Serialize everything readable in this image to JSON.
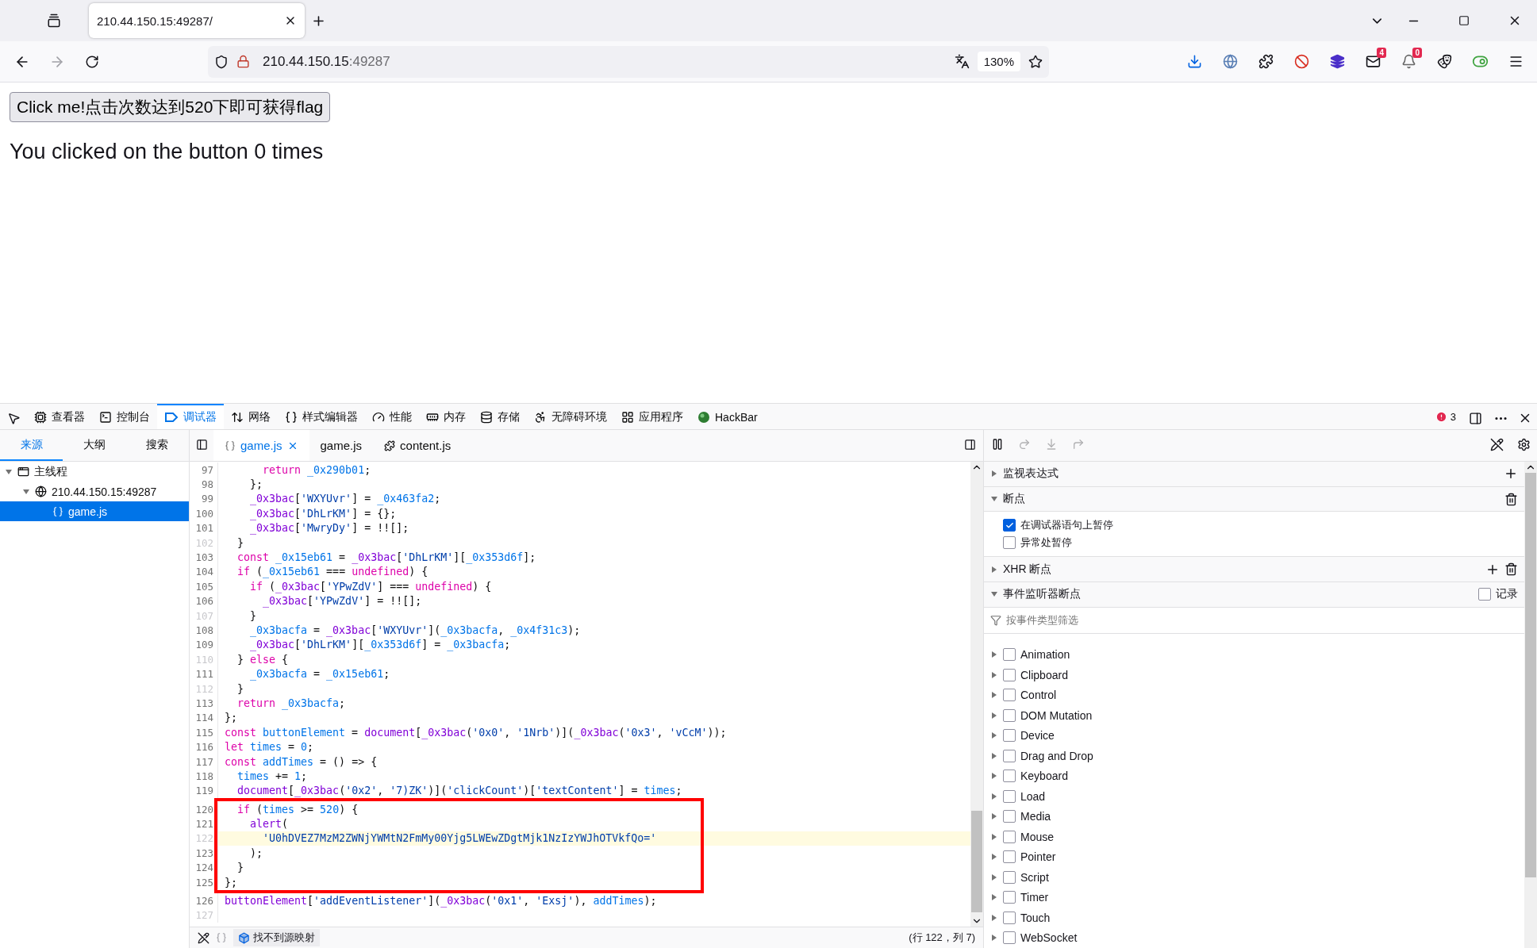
{
  "browser": {
    "tabs": [
      {
        "title": "210.44.150.15:49287/",
        "selected": true
      }
    ],
    "url_host": "210.44.150.15",
    "url_port": ":49287",
    "zoom": "130%",
    "toolbar_icons": [
      {
        "kind": "download"
      },
      {
        "kind": "globe"
      },
      {
        "kind": "puzzle"
      },
      {
        "kind": "stop"
      },
      {
        "kind": "cube"
      },
      {
        "kind": "mail",
        "badge": "4"
      },
      {
        "kind": "bell",
        "badge": "0"
      },
      {
        "kind": "mask"
      },
      {
        "kind": "toggle"
      },
      {
        "kind": "menu"
      }
    ]
  },
  "page": {
    "button": "Click me!点击次数达到520下即可获得flag",
    "message": "You clicked on the button 0 times"
  },
  "devtools": {
    "tools": [
      {
        "kind": "inspector",
        "label": "查看器",
        "selected": false
      },
      {
        "kind": "console",
        "label": "控制台",
        "selected": false
      },
      {
        "kind": "debugger",
        "label": "调试器",
        "selected": true
      },
      {
        "kind": "network",
        "label": "网络",
        "selected": false
      },
      {
        "kind": "style",
        "label": "样式编辑器",
        "selected": false
      },
      {
        "kind": "performance",
        "label": "性能",
        "selected": false
      },
      {
        "kind": "memory",
        "label": "内存",
        "selected": false
      },
      {
        "kind": "storage",
        "label": "存储",
        "selected": false
      },
      {
        "kind": "accessibility",
        "label": "无障碍环境",
        "selected": false
      },
      {
        "kind": "application",
        "label": "应用程序",
        "selected": false
      },
      {
        "kind": "hackbar",
        "label": "HackBar",
        "selected": false
      }
    ],
    "error_count": "3",
    "panel_tabs": [
      {
        "label": "来源",
        "selected": true
      },
      {
        "label": "大纲",
        "selected": false
      },
      {
        "label": "搜索",
        "selected": false
      }
    ],
    "file_tabs": [
      {
        "kind": "pretty",
        "label": "game.js",
        "selected": true
      },
      {
        "kind": "plain",
        "label": "game.js",
        "selected": false
      },
      {
        "kind": "extension",
        "label": "content.js",
        "selected": false
      }
    ],
    "tree": [
      {
        "kind": "thread",
        "label": "主线程",
        "expanded": true,
        "selected": false,
        "children": [
          {
            "kind": "host",
            "label": "210.44.150.15:49287",
            "expanded": true,
            "selected": false,
            "children": [
              {
                "kind": "file",
                "label": "game.js",
                "selected": true
              }
            ]
          }
        ]
      }
    ],
    "code": [
      {
        "n": "97",
        "breakable": true,
        "current": false,
        "boxed": false,
        "tokens": [
          {
            "kind": "kw",
            "text": "      return"
          },
          {
            "kind": "var",
            "text": " _0x290b01"
          },
          {
            "kind": "plain",
            "text": ";"
          }
        ]
      },
      {
        "n": "98",
        "breakable": true,
        "current": false,
        "boxed": false,
        "tokens": [
          {
            "kind": "plain",
            "text": "    };"
          }
        ]
      },
      {
        "n": "99",
        "breakable": true,
        "current": false,
        "boxed": false,
        "tokens": [
          {
            "kind": "fn",
            "text": "    _0x3bac"
          },
          {
            "kind": "plain",
            "text": "["
          },
          {
            "kind": "str",
            "text": "'WXYUvr'"
          },
          {
            "kind": "plain",
            "text": "] ="
          },
          {
            "kind": "var",
            "text": " _0x463fa2"
          },
          {
            "kind": "plain",
            "text": ";"
          }
        ]
      },
      {
        "n": "100",
        "breakable": true,
        "current": false,
        "boxed": false,
        "tokens": [
          {
            "kind": "fn",
            "text": "    _0x3bac"
          },
          {
            "kind": "plain",
            "text": "["
          },
          {
            "kind": "str",
            "text": "'DhLrKM'"
          },
          {
            "kind": "plain",
            "text": "] = {};"
          }
        ]
      },
      {
        "n": "101",
        "breakable": true,
        "current": false,
        "boxed": false,
        "tokens": [
          {
            "kind": "fn",
            "text": "    _0x3bac"
          },
          {
            "kind": "plain",
            "text": "["
          },
          {
            "kind": "str",
            "text": "'MwryDy'"
          },
          {
            "kind": "plain",
            "text": "] = !![];"
          }
        ]
      },
      {
        "n": "102",
        "breakable": false,
        "current": false,
        "boxed": false,
        "tokens": [
          {
            "kind": "plain",
            "text": "  }"
          }
        ]
      },
      {
        "n": "103",
        "breakable": true,
        "current": false,
        "boxed": false,
        "tokens": [
          {
            "kind": "kw",
            "text": "  const"
          },
          {
            "kind": "var",
            "text": " _0x15eb61"
          },
          {
            "kind": "plain",
            "text": " ="
          },
          {
            "kind": "fn",
            "text": " _0x3bac"
          },
          {
            "kind": "plain",
            "text": "["
          },
          {
            "kind": "str",
            "text": "'DhLrKM'"
          },
          {
            "kind": "plain",
            "text": "]["
          },
          {
            "kind": "var",
            "text": "_0x353d6f"
          },
          {
            "kind": "plain",
            "text": "];"
          }
        ]
      },
      {
        "n": "104",
        "breakable": true,
        "current": false,
        "boxed": false,
        "tokens": [
          {
            "kind": "kw",
            "text": "  if"
          },
          {
            "kind": "plain",
            "text": " ("
          },
          {
            "kind": "var",
            "text": "_0x15eb61"
          },
          {
            "kind": "plain",
            "text": " ==="
          },
          {
            "kind": "kw",
            "text": " undefined"
          },
          {
            "kind": "plain",
            "text": ") {"
          }
        ]
      },
      {
        "n": "105",
        "breakable": true,
        "current": false,
        "boxed": false,
        "tokens": [
          {
            "kind": "kw",
            "text": "    if"
          },
          {
            "kind": "plain",
            "text": " ("
          },
          {
            "kind": "fn",
            "text": "_0x3bac"
          },
          {
            "kind": "plain",
            "text": "["
          },
          {
            "kind": "str",
            "text": "'YPwZdV'"
          },
          {
            "kind": "plain",
            "text": "] ==="
          },
          {
            "kind": "kw",
            "text": " undefined"
          },
          {
            "kind": "plain",
            "text": ") {"
          }
        ]
      },
      {
        "n": "106",
        "breakable": true,
        "current": false,
        "boxed": false,
        "tokens": [
          {
            "kind": "fn",
            "text": "      _0x3bac"
          },
          {
            "kind": "plain",
            "text": "["
          },
          {
            "kind": "str",
            "text": "'YPwZdV'"
          },
          {
            "kind": "plain",
            "text": "] = !![];"
          }
        ]
      },
      {
        "n": "107",
        "breakable": false,
        "current": false,
        "boxed": false,
        "tokens": [
          {
            "kind": "plain",
            "text": "    }"
          }
        ]
      },
      {
        "n": "108",
        "breakable": true,
        "current": false,
        "boxed": false,
        "tokens": [
          {
            "kind": "var",
            "text": "    _0x3bacfa"
          },
          {
            "kind": "plain",
            "text": " ="
          },
          {
            "kind": "fn",
            "text": " _0x3bac"
          },
          {
            "kind": "plain",
            "text": "["
          },
          {
            "kind": "str",
            "text": "'WXYUvr'"
          },
          {
            "kind": "plain",
            "text": "]("
          },
          {
            "kind": "var",
            "text": "_0x3bacfa"
          },
          {
            "kind": "plain",
            "text": ","
          },
          {
            "kind": "var",
            "text": " _0x4f31c3"
          },
          {
            "kind": "plain",
            "text": ");"
          }
        ]
      },
      {
        "n": "109",
        "breakable": true,
        "current": false,
        "boxed": false,
        "tokens": [
          {
            "kind": "fn",
            "text": "    _0x3bac"
          },
          {
            "kind": "plain",
            "text": "["
          },
          {
            "kind": "str",
            "text": "'DhLrKM'"
          },
          {
            "kind": "plain",
            "text": "]["
          },
          {
            "kind": "var",
            "text": "_0x353d6f"
          },
          {
            "kind": "plain",
            "text": "] ="
          },
          {
            "kind": "var",
            "text": " _0x3bacfa"
          },
          {
            "kind": "plain",
            "text": ";"
          }
        ]
      },
      {
        "n": "110",
        "breakable": false,
        "current": false,
        "boxed": false,
        "tokens": [
          {
            "kind": "plain",
            "text": "  }"
          },
          {
            "kind": "kw",
            "text": " else"
          },
          {
            "kind": "plain",
            "text": " {"
          }
        ]
      },
      {
        "n": "111",
        "breakable": true,
        "current": false,
        "boxed": false,
        "tokens": [
          {
            "kind": "var",
            "text": "    _0x3bacfa"
          },
          {
            "kind": "plain",
            "text": " ="
          },
          {
            "kind": "var",
            "text": " _0x15eb61"
          },
          {
            "kind": "plain",
            "text": ";"
          }
        ]
      },
      {
        "n": "112",
        "breakable": false,
        "current": false,
        "boxed": false,
        "tokens": [
          {
            "kind": "plain",
            "text": "  }"
          }
        ]
      },
      {
        "n": "113",
        "breakable": true,
        "current": false,
        "boxed": false,
        "tokens": [
          {
            "kind": "kw",
            "text": "  return"
          },
          {
            "kind": "var",
            "text": " _0x3bacfa"
          },
          {
            "kind": "plain",
            "text": ";"
          }
        ]
      },
      {
        "n": "114",
        "breakable": true,
        "current": false,
        "boxed": false,
        "tokens": [
          {
            "kind": "plain",
            "text": "};"
          }
        ]
      },
      {
        "n": "115",
        "breakable": true,
        "current": false,
        "boxed": false,
        "tokens": [
          {
            "kind": "kw",
            "text": "const"
          },
          {
            "kind": "var",
            "text": " buttonElement"
          },
          {
            "kind": "plain",
            "text": " ="
          },
          {
            "kind": "fn",
            "text": " document"
          },
          {
            "kind": "plain",
            "text": "["
          },
          {
            "kind": "fn",
            "text": "_0x3bac"
          },
          {
            "kind": "plain",
            "text": "("
          },
          {
            "kind": "str",
            "text": "'0x0'"
          },
          {
            "kind": "plain",
            "text": ","
          },
          {
            "kind": "str",
            "text": " '1Nrb'"
          },
          {
            "kind": "plain",
            "text": ")]("
          },
          {
            "kind": "fn",
            "text": "_0x3bac"
          },
          {
            "kind": "plain",
            "text": "("
          },
          {
            "kind": "str",
            "text": "'0x3'"
          },
          {
            "kind": "plain",
            "text": ","
          },
          {
            "kind": "str",
            "text": " 'vCcM'"
          },
          {
            "kind": "plain",
            "text": "));"
          }
        ]
      },
      {
        "n": "116",
        "breakable": true,
        "current": false,
        "boxed": false,
        "tokens": [
          {
            "kind": "kw",
            "text": "let"
          },
          {
            "kind": "var",
            "text": " times"
          },
          {
            "kind": "plain",
            "text": " ="
          },
          {
            "kind": "num",
            "text": " 0"
          },
          {
            "kind": "plain",
            "text": ";"
          }
        ]
      },
      {
        "n": "117",
        "breakable": true,
        "current": false,
        "boxed": false,
        "tokens": [
          {
            "kind": "kw",
            "text": "const"
          },
          {
            "kind": "var",
            "text": " addTimes"
          },
          {
            "kind": "plain",
            "text": " = () => {"
          }
        ]
      },
      {
        "n": "118",
        "breakable": true,
        "current": false,
        "boxed": false,
        "tokens": [
          {
            "kind": "var",
            "text": "  times"
          },
          {
            "kind": "plain",
            "text": " +="
          },
          {
            "kind": "num",
            "text": " 1"
          },
          {
            "kind": "plain",
            "text": ";"
          }
        ]
      },
      {
        "n": "119",
        "breakable": true,
        "current": false,
        "boxed": false,
        "tokens": [
          {
            "kind": "fn",
            "text": "  document"
          },
          {
            "kind": "plain",
            "text": "["
          },
          {
            "kind": "fn",
            "text": "_0x3bac"
          },
          {
            "kind": "plain",
            "text": "("
          },
          {
            "kind": "str",
            "text": "'0x2'"
          },
          {
            "kind": "plain",
            "text": ","
          },
          {
            "kind": "str",
            "text": " '7)ZK'"
          },
          {
            "kind": "plain",
            "text": ")]("
          },
          {
            "kind": "str",
            "text": "'clickCount'"
          },
          {
            "kind": "plain",
            "text": ")["
          },
          {
            "kind": "str",
            "text": "'textContent'"
          },
          {
            "kind": "plain",
            "text": "] ="
          },
          {
            "kind": "var",
            "text": " times"
          },
          {
            "kind": "plain",
            "text": ";"
          }
        ]
      },
      {
        "n": "120",
        "breakable": true,
        "current": false,
        "boxed": true,
        "tokens": [
          {
            "kind": "kw",
            "text": "  if"
          },
          {
            "kind": "plain",
            "text": " ("
          },
          {
            "kind": "var",
            "text": "times"
          },
          {
            "kind": "plain",
            "text": " >="
          },
          {
            "kind": "num",
            "text": " 520"
          },
          {
            "kind": "plain",
            "text": ") {"
          }
        ]
      },
      {
        "n": "121",
        "breakable": true,
        "current": false,
        "boxed": true,
        "tokens": [
          {
            "kind": "fn",
            "text": "    alert"
          },
          {
            "kind": "plain",
            "text": "("
          }
        ]
      },
      {
        "n": "122",
        "breakable": false,
        "current": true,
        "boxed": true,
        "tokens": [
          {
            "kind": "str",
            "text": "      'U0hDVEZ7MzM2ZWNjYWMtN2FmMy00Yjg5LWEwZDgtMjk1NzIzYWJhOTVkfQo='"
          }
        ]
      },
      {
        "n": "123",
        "breakable": true,
        "current": false,
        "boxed": true,
        "tokens": [
          {
            "kind": "plain",
            "text": "    );"
          }
        ]
      },
      {
        "n": "124",
        "breakable": true,
        "current": false,
        "boxed": true,
        "tokens": [
          {
            "kind": "plain",
            "text": "  }"
          }
        ]
      },
      {
        "n": "125",
        "breakable": true,
        "current": false,
        "boxed": true,
        "tokens": [
          {
            "kind": "plain",
            "text": "};"
          }
        ]
      },
      {
        "n": "126",
        "breakable": true,
        "current": false,
        "boxed": false,
        "tokens": [
          {
            "kind": "fn",
            "text": "buttonElement"
          },
          {
            "kind": "plain",
            "text": "["
          },
          {
            "kind": "str",
            "text": "'addEventListener'"
          },
          {
            "kind": "plain",
            "text": "]("
          },
          {
            "kind": "fn",
            "text": "_0x3bac"
          },
          {
            "kind": "plain",
            "text": "("
          },
          {
            "kind": "str",
            "text": "'0x1'"
          },
          {
            "kind": "plain",
            "text": ","
          },
          {
            "kind": "str",
            "text": " 'Exsj'"
          },
          {
            "kind": "plain",
            "text": "),"
          },
          {
            "kind": "var",
            "text": " addTimes"
          },
          {
            "kind": "plain",
            "text": ");"
          }
        ]
      },
      {
        "n": "127",
        "breakable": false,
        "current": false,
        "boxed": false
      }
    ],
    "status": {
      "source_map": "找不到源映射",
      "position": "(行 122，列 7)"
    },
    "sections": [
      {
        "kind": "watch",
        "title": "监视表达式",
        "expanded": false
      },
      {
        "kind": "breakpoints",
        "title": "断点",
        "expanded": true,
        "options": [
          {
            "label": "在调试器语句上暂停",
            "checked": true
          },
          {
            "label": "异常处暂停",
            "checked": false
          }
        ]
      },
      {
        "kind": "xhr",
        "title": "XHR 断点",
        "expanded": false
      },
      {
        "kind": "events",
        "title": "事件监听器断点",
        "expanded": true,
        "log": {
          "label": "记录",
          "checked": false
        },
        "filter_placeholder": "按事件类型筛选",
        "events": [
          {
            "label": "Animation",
            "checked": false,
            "expanded": false
          },
          {
            "label": "Clipboard",
            "checked": false,
            "expanded": false
          },
          {
            "label": "Control",
            "checked": false,
            "expanded": false
          },
          {
            "label": "DOM Mutation",
            "checked": false,
            "expanded": false
          },
          {
            "label": "Device",
            "checked": false,
            "expanded": false
          },
          {
            "label": "Drag and Drop",
            "checked": false,
            "expanded": false
          },
          {
            "label": "Keyboard",
            "checked": false,
            "expanded": false
          },
          {
            "label": "Load",
            "checked": false,
            "expanded": false
          },
          {
            "label": "Media",
            "checked": false,
            "expanded": false
          },
          {
            "label": "Mouse",
            "checked": false,
            "expanded": false
          },
          {
            "label": "Pointer",
            "checked": false,
            "expanded": false
          },
          {
            "label": "Script",
            "checked": false,
            "expanded": false
          },
          {
            "label": "Timer",
            "checked": false,
            "expanded": false
          },
          {
            "label": "Touch",
            "checked": false,
            "expanded": false
          },
          {
            "label": "WebSocket",
            "checked": false,
            "expanded": false
          }
        ]
      }
    ]
  }
}
